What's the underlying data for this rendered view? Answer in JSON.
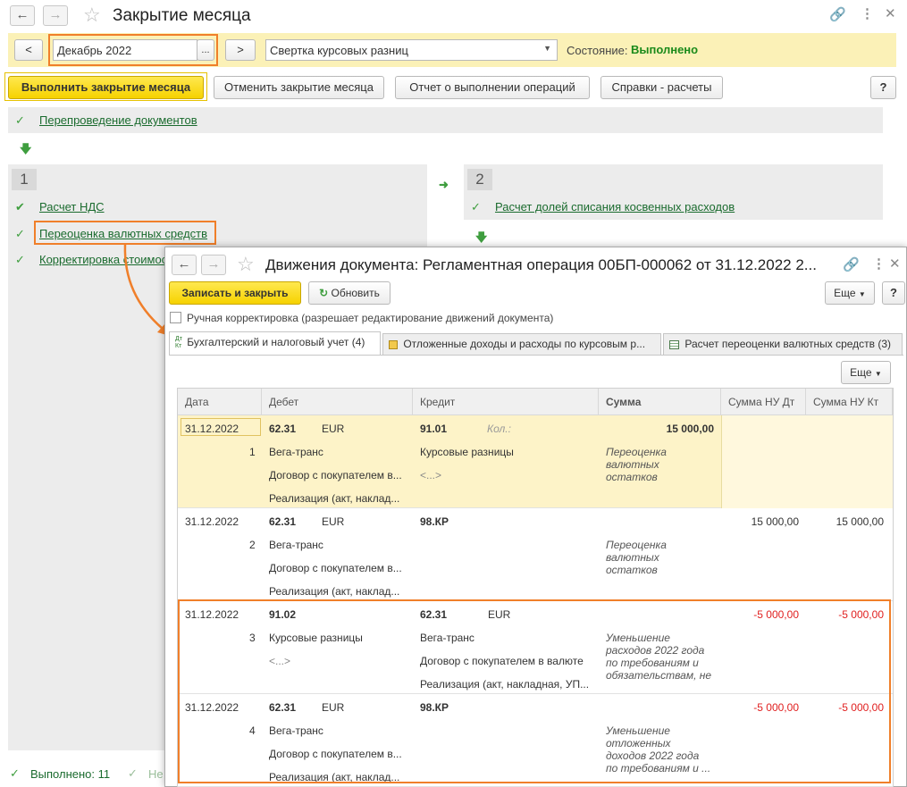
{
  "window": {
    "title": "Закрытие месяца"
  },
  "period": {
    "prev": "<",
    "value": "Декабрь 2022",
    "select": "...",
    "next": ">",
    "operation": "Свертка курсовых разниц",
    "status_label": "Состояние:",
    "status_value": "Выполнено"
  },
  "toolbar": {
    "run": "Выполнить закрытие месяца",
    "cancel": "Отменить закрытие месяца",
    "report": "Отчет о выполнении операций",
    "refs": "Справки - расчеты",
    "help": "?"
  },
  "steps": {
    "top": "Перепроведение документов",
    "group1_num": "1",
    "group1_items": [
      "Расчет НДС",
      "Переоценка валютных средств",
      "Корректировка стоимос"
    ],
    "group2_num": "2",
    "group2_items": [
      "Расчет долей списания косвенных расходов"
    ]
  },
  "footer": {
    "done": "Выполнено: 11",
    "other": "Не"
  },
  "dialog": {
    "title": "Движения документа: Регламентная операция 00БП-000062 от 31.12.2022 2...",
    "save_close": "Записать и закрыть",
    "refresh": "Обновить",
    "more": "Еще",
    "help": "?",
    "manual_edit": "Ручная корректировка (разрешает редактирование движений документа)",
    "tabs": [
      "Бухгалтерский и налоговый учет (4)",
      "Отложенные доходы и расходы по курсовым р...",
      "Расчет переоценки валютных средств (3)"
    ],
    "table_more": "Еще",
    "columns": [
      "Дата",
      "Дебет",
      "Кредит",
      "Сумма",
      "Сумма НУ Дт",
      "Сумма НУ Кт"
    ],
    "rows": [
      {
        "date": "31.12.2022",
        "num": "1",
        "dt_account": "62.31",
        "dt_currency": "EUR",
        "dt_sub": [
          "Вега-транс",
          "Договор с покупателем в...",
          "Реализация (акт, наклад..."
        ],
        "kt_account": "91.01",
        "kt_qty": "Кол.:",
        "kt_sub": [
          "Курсовые разницы",
          "<...>"
        ],
        "sum": "15 000,00",
        "content": "Переоценка валютных остатков",
        "nu_dt": "",
        "nu_kt": ""
      },
      {
        "date": "31.12.2022",
        "num": "2",
        "dt_account": "62.31",
        "dt_currency": "EUR",
        "dt_sub": [
          "Вега-транс",
          "Договор с покупателем в...",
          "Реализация (акт, наклад..."
        ],
        "kt_account": "98.КР",
        "kt_qty": "",
        "kt_sub": [],
        "sum": "",
        "content": "Переоценка валютных остатков",
        "nu_dt": "15 000,00",
        "nu_kt": "15 000,00"
      },
      {
        "date": "31.12.2022",
        "num": "3",
        "dt_account": "91.02",
        "dt_currency": "",
        "dt_sub": [
          "Курсовые разницы",
          "<...>"
        ],
        "kt_account": "62.31",
        "kt_currency": "EUR",
        "kt_sub": [
          "Вега-транс",
          "Договор с покупателем в валюте",
          "Реализация (акт, накладная, УП..."
        ],
        "sum": "",
        "content": "Уменьшение расходов 2022 года по требованиям и обязательствам, не",
        "nu_dt": "-5 000,00",
        "nu_kt": "-5 000,00"
      },
      {
        "date": "31.12.2022",
        "num": "4",
        "dt_account": "62.31",
        "dt_currency": "EUR",
        "dt_sub": [
          "Вега-транс",
          "Договор с покупателем в...",
          "Реализация (акт, наклад..."
        ],
        "kt_account": "98.КР",
        "kt_qty": "",
        "kt_sub": [],
        "sum": "",
        "content": "Уменьшение отложенных доходов 2022 года по требованиям и ...",
        "nu_dt": "-5 000,00",
        "nu_kt": "-5 000,00"
      }
    ]
  },
  "icons": {
    "back": "arrow-left-icon",
    "forward": "arrow-right-icon",
    "favorite": "star-icon",
    "link": "link-icon",
    "menu": "more-vertical-icon",
    "close": "close-icon",
    "check": "check-icon",
    "down": "arrow-down-icon",
    "refresh": "refresh-icon"
  },
  "colors": {
    "accent_yellow": "#f6d200",
    "highlight_orange": "#f07f2a",
    "success_green": "#1a8a1a",
    "link_green": "#1a6b2e",
    "negative_red": "#e02020",
    "selected_row": "#fdf3c8"
  }
}
